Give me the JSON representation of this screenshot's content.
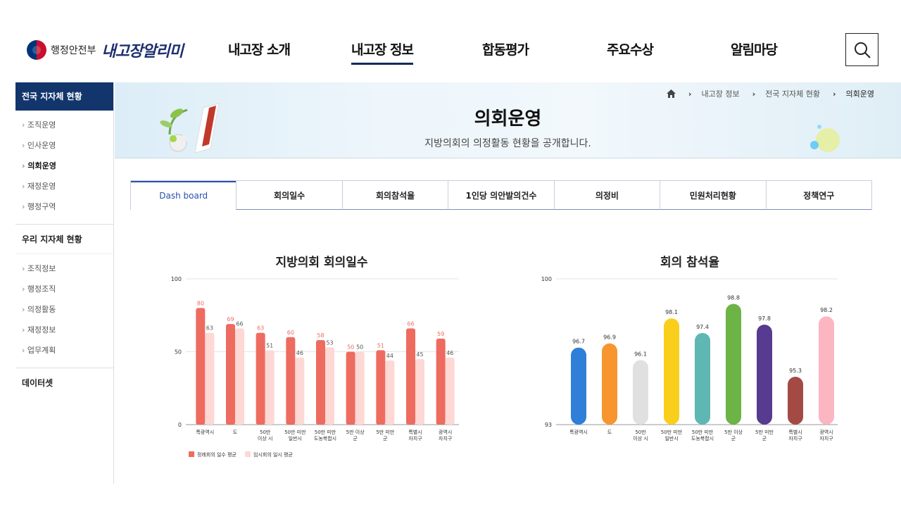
{
  "header": {
    "ministry": "행정안전부",
    "site_name": "내고장알리미",
    "nav": [
      "내고장 소개",
      "내고장 정보",
      "합동평가",
      "주요수상",
      "알림마당"
    ],
    "active_nav": 1
  },
  "sidebar": {
    "title": "전국 지자체 현황",
    "items": [
      "조직운영",
      "인사운영",
      "의회운영",
      "재정운영",
      "행정구역"
    ],
    "section2_title": "우리 지자체 현황",
    "items2": [
      "조직정보",
      "행정조직",
      "의정활동",
      "재정정보",
      "업무계획"
    ],
    "section3_title": "데이터셋"
  },
  "breadcrumb": [
    "내고장 정보",
    "전국 지자체 현황",
    "의회운영"
  ],
  "banner": {
    "title": "의회운영",
    "desc": "지방의회의 의정활동 현황을 공개합니다."
  },
  "tabs": [
    "Dash board",
    "회의일수",
    "회의참석율",
    "1인당 의안발의건수",
    "의정비",
    "민원처리현황",
    "정책연구"
  ],
  "chart_data": [
    {
      "type": "bar",
      "title": "지방의회 회의일수",
      "categories": [
        [
          "특광역시"
        ],
        [
          "도"
        ],
        [
          "50만",
          "이상 시"
        ],
        [
          "50만 미만",
          "일반시"
        ],
        [
          "50만 미만",
          "도농복합시"
        ],
        [
          "5만 이상",
          "군"
        ],
        [
          "5만 미만",
          "군"
        ],
        [
          "특별시",
          "자치구"
        ],
        [
          "광역시",
          "자치구"
        ]
      ],
      "ylim": [
        0,
        100
      ],
      "yticks": [
        "0",
        "50",
        "100"
      ],
      "series": [
        {
          "name": "정례회의 일수 평균",
          "color": "#ee6b60",
          "values": [
            80,
            69,
            63,
            60,
            58,
            50,
            51,
            66,
            59
          ]
        },
        {
          "name": "임시회의 일시 평균",
          "color": "#fdd8d4",
          "values": [
            63,
            66,
            51,
            46,
            53,
            50,
            44,
            45,
            46
          ]
        }
      ]
    },
    {
      "type": "bar",
      "title": "회의 참석율",
      "categories": [
        [
          "특광역시"
        ],
        [
          "도"
        ],
        [
          "50만",
          "이상 시"
        ],
        [
          "50만 미만",
          "일반시"
        ],
        [
          "50만 미만",
          "도농복합시"
        ],
        [
          "5만 이상",
          "군"
        ],
        [
          "5만 미만",
          "군"
        ],
        [
          "특별시",
          "자치구"
        ],
        [
          "광역시",
          "자치구"
        ]
      ],
      "ylim": [
        93,
        100
      ],
      "yticks": [
        "93",
        "100"
      ],
      "values": [
        96.7,
        96.9,
        96.1,
        98.1,
        97.4,
        98.8,
        97.8,
        95.3,
        98.2
      ],
      "colors": [
        "#2f7fd8",
        "#f7962f",
        "#e0e0e0",
        "#f9cf1c",
        "#5fb7b4",
        "#6cb445",
        "#563b90",
        "#a44a45",
        "#fbb6c1"
      ]
    }
  ]
}
